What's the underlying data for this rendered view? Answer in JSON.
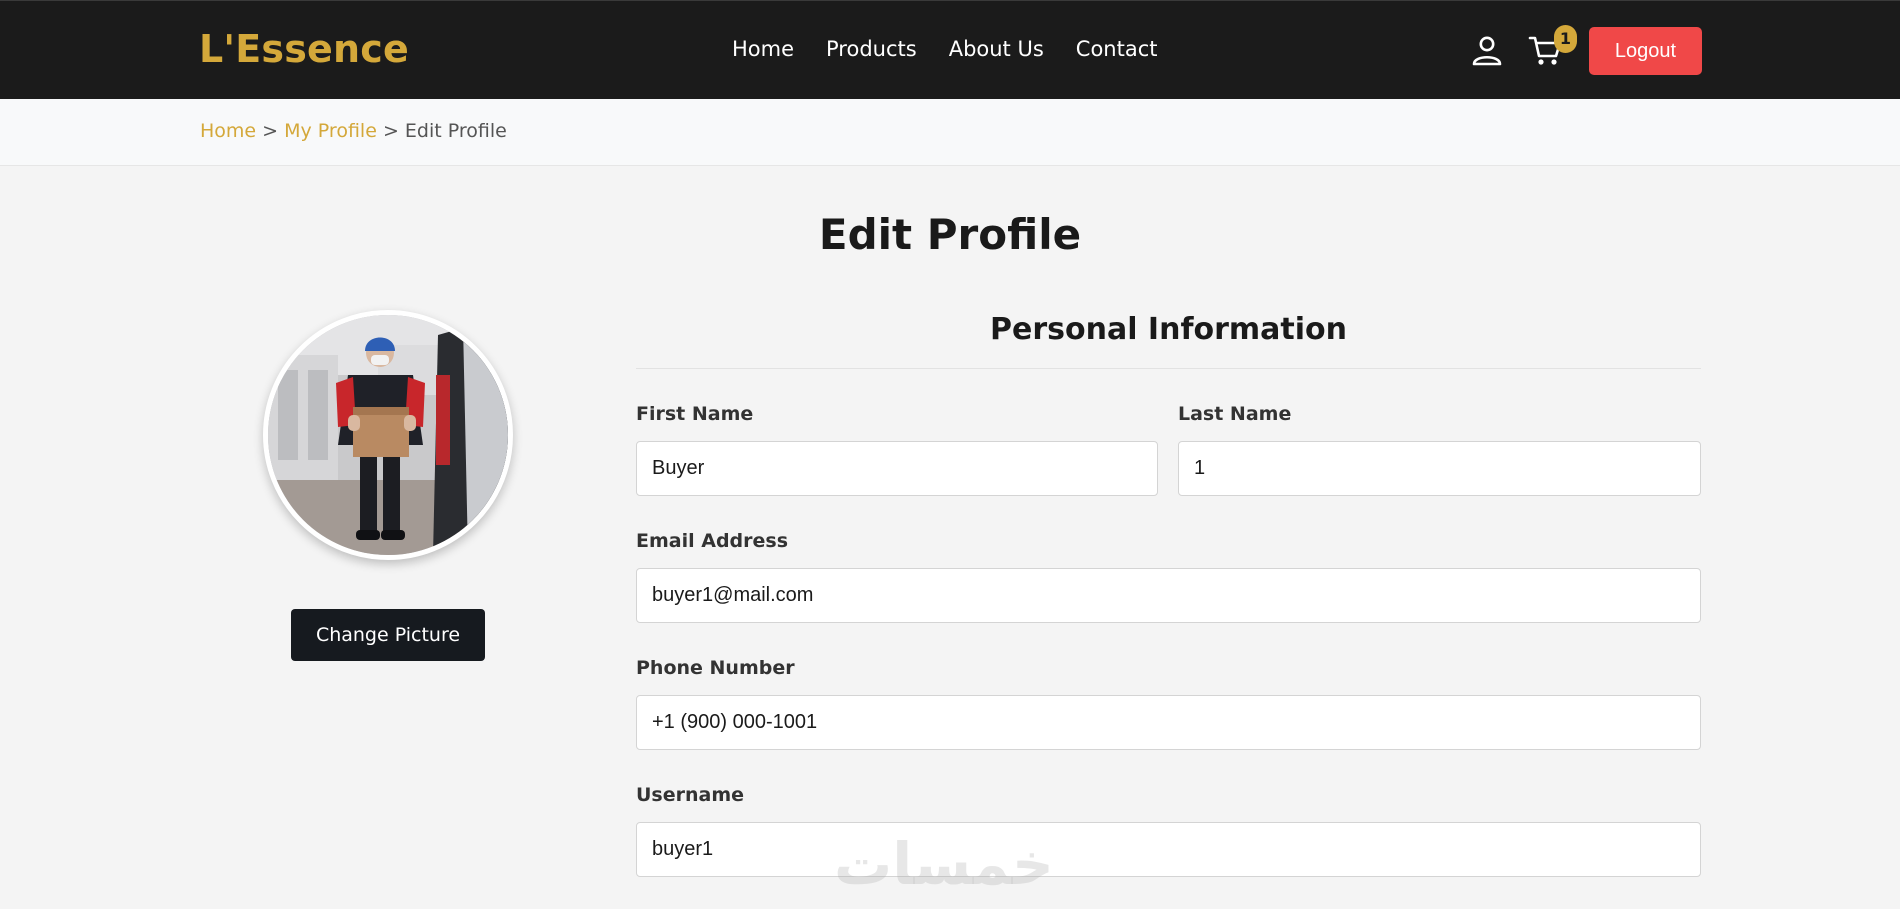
{
  "nav": {
    "brand": "L'Essence",
    "links": [
      "Home",
      "Products",
      "About Us",
      "Contact"
    ],
    "cart_count": "1",
    "logout_label": "Logout"
  },
  "breadcrumb": {
    "home": "Home",
    "profile": "My Profile",
    "current": "Edit Profile",
    "separator": ">"
  },
  "page": {
    "title": "Edit Profile"
  },
  "avatar": {
    "change_label": "Change Picture"
  },
  "form": {
    "section_title": "Personal Information",
    "first_name_label": "First Name",
    "first_name_value": "Buyer",
    "last_name_label": "Last Name",
    "last_name_value": "1",
    "email_label": "Email Address",
    "email_value": "buyer1@mail.com",
    "phone_label": "Phone Number",
    "phone_value": "+1 (900) 000-1001",
    "username_label": "Username",
    "username_value": "buyer1"
  },
  "watermark": "خمسات",
  "colors": {
    "brand_gold": "#d4a83a",
    "navbar_bg": "#1b1b1b",
    "logout_red": "#f04848",
    "dark_button": "#161a1f",
    "page_bg": "#f4f4f4"
  },
  "icons": {
    "user": "user-icon",
    "cart": "cart-icon"
  }
}
